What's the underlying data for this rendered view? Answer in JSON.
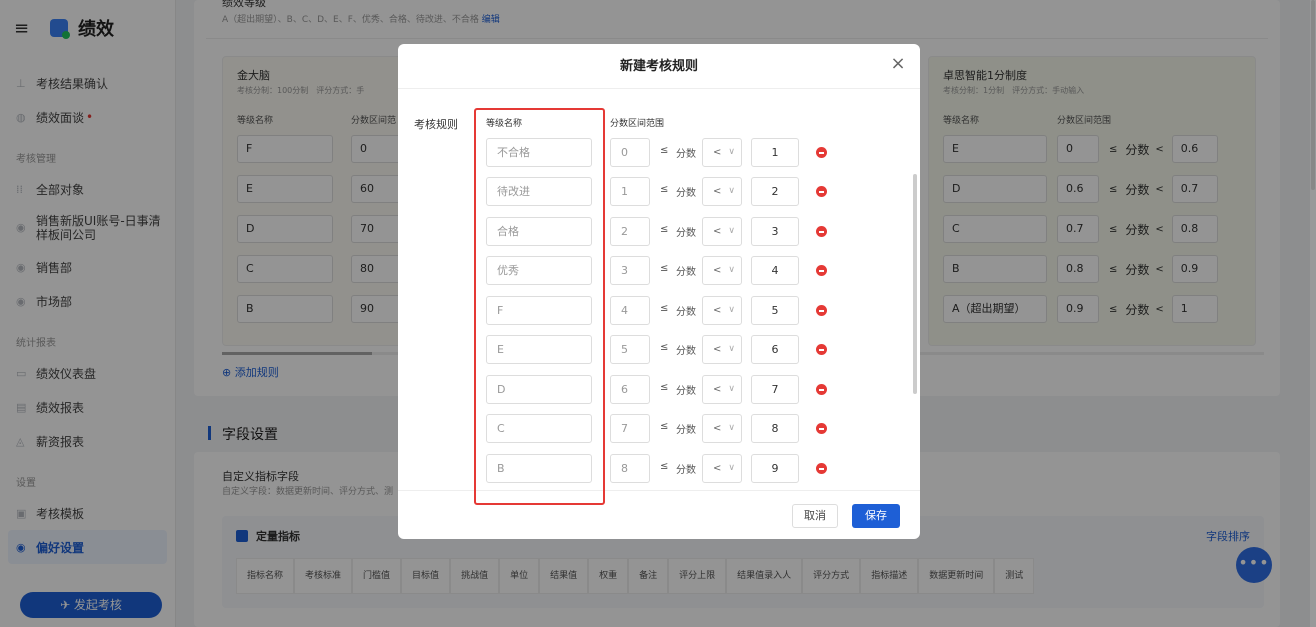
{
  "sidebar": {
    "title": "绩效",
    "items": [
      {
        "label": "考核结果确认",
        "icon": "stamp-icon"
      },
      {
        "label": "绩效面谈",
        "icon": "chat-icon",
        "dot": "•"
      }
    ],
    "group_manage": "考核管理",
    "manage_items": [
      {
        "label": "全部对象",
        "icon": "grid-icon"
      },
      {
        "label": "销售新版UI账号-日事清样板间公司",
        "icon": "building-icon"
      },
      {
        "label": "销售部",
        "icon": "dept-icon"
      },
      {
        "label": "市场部",
        "icon": "dept-icon"
      }
    ],
    "group_stats": "统计报表",
    "stats_items": [
      {
        "label": "绩效仪表盘",
        "icon": "dashboard-icon"
      },
      {
        "label": "绩效报表",
        "icon": "report-icon"
      },
      {
        "label": "薪资报表",
        "icon": "salary-icon"
      }
    ],
    "group_settings": "设置",
    "settings_items": [
      {
        "label": "考核模板",
        "icon": "template-icon"
      },
      {
        "label": "偏好设置",
        "icon": "settings-icon"
      }
    ],
    "launch_button": "✈ 发起考核"
  },
  "background": {
    "grade_section_title": "绩效等级",
    "grade_section_sub": "A（超出期望）、B、C、D、E、F、优秀、合格、待改进、不合格",
    "grade_edit": "编辑",
    "left_card": {
      "name": "金大脑",
      "meta": "考核分制：100分制　评分方式：手",
      "col_name": "等级名称",
      "col_range": "分数区间范",
      "rows": [
        {
          "name": "F",
          "lo": "0"
        },
        {
          "name": "E",
          "lo": "60"
        },
        {
          "name": "D",
          "lo": "70"
        },
        {
          "name": "C",
          "lo": "80"
        },
        {
          "name": "B",
          "lo": "90"
        }
      ]
    },
    "right_card": {
      "name": "卓思智能1分制度",
      "meta": "考核分制：1分制　评分方式：手动输入",
      "col_name": "等级名称",
      "col_range": "分数区间范围",
      "rows": [
        {
          "name": "E",
          "lo": "0",
          "hi": "0.6"
        },
        {
          "name": "D",
          "lo": "0.6",
          "hi": "0.7"
        },
        {
          "name": "C",
          "lo": "0.7",
          "hi": "0.8"
        },
        {
          "name": "B",
          "lo": "0.8",
          "hi": "0.9"
        },
        {
          "name": "A（超出期望）",
          "lo": "0.9",
          "hi": "1"
        }
      ],
      "le": "≤",
      "score": "分数",
      "lt": "<"
    },
    "add_rule": "⊕ 添加规则",
    "field_settings_title": "字段设置",
    "custom_field_title": "自定义指标字段",
    "custom_field_sub": "自定义字段：数据更新时间、评分方式、测",
    "quant_title": "定量指标",
    "field_sort": "字段排序",
    "table_columns": [
      "指标名称",
      "考核标准",
      "门槛值",
      "目标值",
      "挑战值",
      "单位",
      "结果值",
      "权重",
      "备注",
      "评分上限",
      "结果值录入人",
      "评分方式",
      "指标描述",
      "数据更新时间",
      "测试"
    ],
    "fab": "•••"
  },
  "modal": {
    "title": "新建考核规则",
    "close": "×",
    "rule_label": "考核规则",
    "col_name": "等级名称",
    "col_range": "分数区间范围",
    "le": "≤",
    "score": "分数",
    "op": "<",
    "chev": "∨",
    "rows": [
      {
        "name": "不合格",
        "lo": "0",
        "hi": "1"
      },
      {
        "name": "待改进",
        "lo": "1",
        "hi": "2"
      },
      {
        "name": "合格",
        "lo": "2",
        "hi": "3"
      },
      {
        "name": "优秀",
        "lo": "3",
        "hi": "4"
      },
      {
        "name": "F",
        "lo": "4",
        "hi": "5"
      },
      {
        "name": "E",
        "lo": "5",
        "hi": "6"
      },
      {
        "name": "D",
        "lo": "6",
        "hi": "7"
      },
      {
        "name": "C",
        "lo": "7",
        "hi": "8"
      },
      {
        "name": "B",
        "lo": "8",
        "hi": "9"
      }
    ],
    "cancel": "取消",
    "save": "保存"
  },
  "colors": {
    "accent": "#1e5fd6",
    "danger": "#e53935",
    "annotation": "#e53935"
  }
}
